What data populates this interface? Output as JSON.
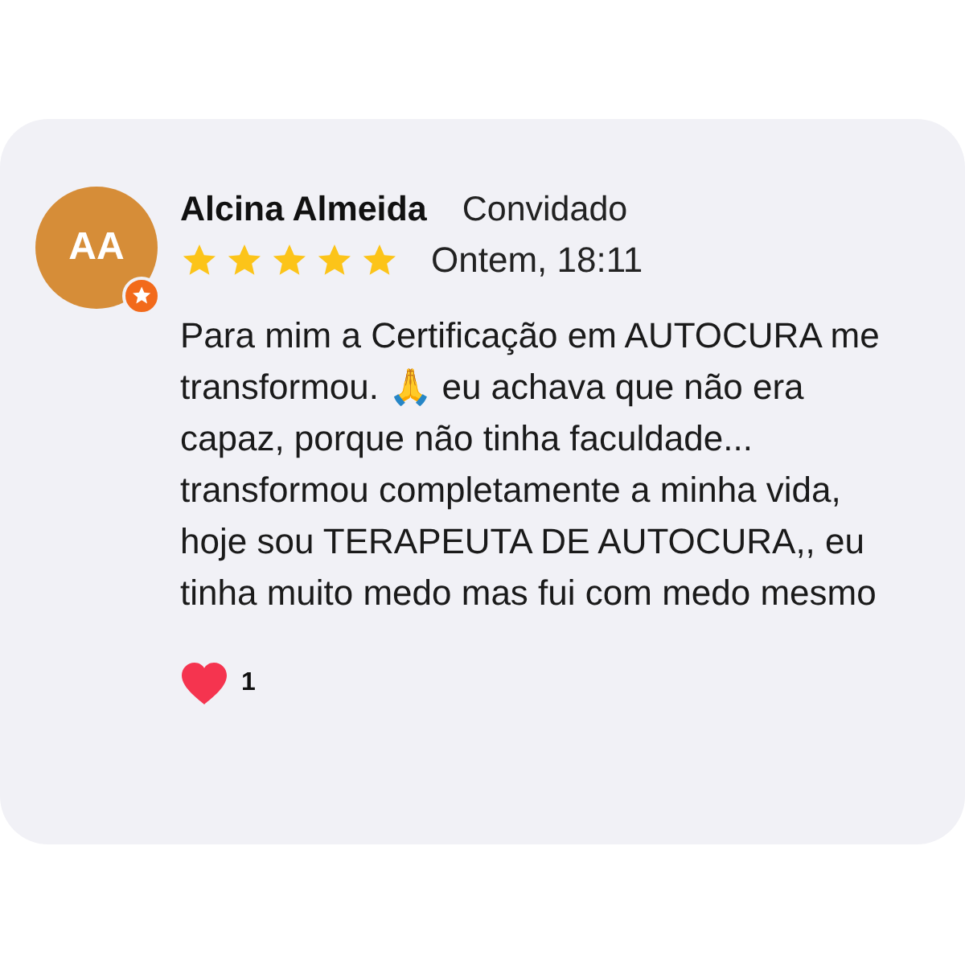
{
  "review": {
    "avatar_initials": "AA",
    "author": "Alcina Almeida",
    "role": "Convidado",
    "stars": 5,
    "date": "Ontem, 18:11",
    "text": "Para mim a Certificação em AUTOCURA me transformou. 🙏 eu achava que não era capaz, porque não tinha faculdade... transformou completamente a minha vida, hoje sou TERAPEUTA DE AUTOCURA,, eu tinha muito medo mas fui com medo mesmo",
    "likes": "1",
    "liked": true
  }
}
